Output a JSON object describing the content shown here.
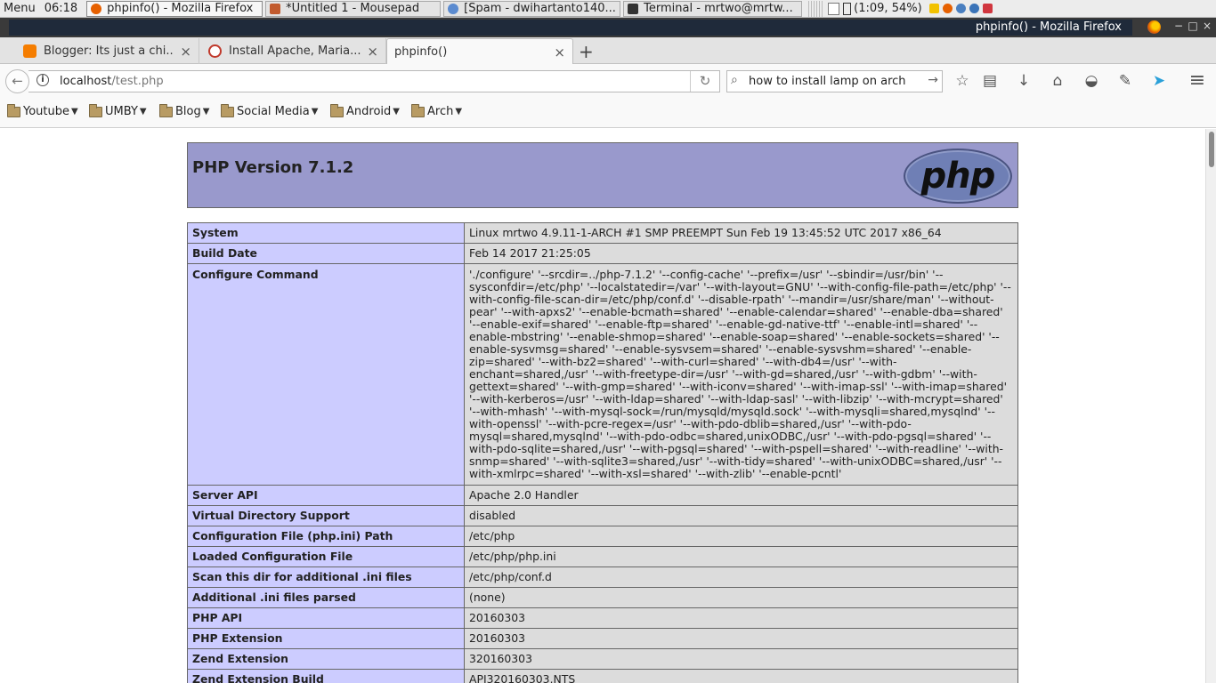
{
  "taskbar": {
    "menu": "Menu",
    "clock": "06:18",
    "tasks": [
      {
        "label": "phpinfo() - Mozilla Firefox",
        "color": "#e66000"
      },
      {
        "label": "*Untitled 1 - Mousepad",
        "color": "#c25b2e"
      },
      {
        "label": "[Spam - dwihartanto140...",
        "color": "#5b8bd0"
      },
      {
        "label": "Terminal - mrtwo@mrtw...",
        "color": "#333333"
      }
    ],
    "battery": "(1:09, 54%)"
  },
  "window": {
    "title": "phpinfo() - Mozilla Firefox",
    "controls": {
      "minimize": "−",
      "maximize": "□",
      "close": "×"
    }
  },
  "tabs": [
    {
      "label": "Blogger: Its just a chi...",
      "favicon_color": "#f57d00"
    },
    {
      "label": "Install Apache, Maria...",
      "favicon_color": "#c0392b"
    },
    {
      "label": "phpinfo()",
      "favicon_color": ""
    }
  ],
  "newtab": "+",
  "navbar": {
    "back": "←",
    "info": "i",
    "url_host": "localhost",
    "url_path": "/test.php",
    "reload": "↻",
    "search_icon": "magnifier-icon",
    "search_text": "how to install lamp on arch",
    "search_go": "→",
    "icons": {
      "bookmark_star": "☆",
      "reading_list": "▤",
      "downloads": "↓",
      "home": "⌂",
      "pocket": "◒",
      "extension": "✎",
      "telegram": "➤",
      "menu": "≡"
    }
  },
  "bookmarks": [
    "Youtube",
    "UMBY",
    "Blog",
    "Social Media",
    "Android",
    "Arch"
  ],
  "php": {
    "version_title": "PHP Version 7.1.2",
    "logo_text": "php",
    "rows": [
      {
        "key": "System",
        "value": "Linux mrtwo 4.9.11-1-ARCH #1 SMP PREEMPT Sun Feb 19 13:45:52 UTC 2017 x86_64"
      },
      {
        "key": "Build Date",
        "value": "Feb 14 2017 21:25:05"
      },
      {
        "key": "Configure Command",
        "value": "'./configure' '--srcdir=../php-7.1.2' '--config-cache' '--prefix=/usr' '--sbindir=/usr/bin' '--sysconfdir=/etc/php' '--localstatedir=/var' '--with-layout=GNU' '--with-config-file-path=/etc/php' '--with-config-file-scan-dir=/etc/php/conf.d' '--disable-rpath' '--mandir=/usr/share/man' '--without-pear' '--with-apxs2' '--enable-bcmath=shared' '--enable-calendar=shared' '--enable-dba=shared' '--enable-exif=shared' '--enable-ftp=shared' '--enable-gd-native-ttf' '--enable-intl=shared' '--enable-mbstring' '--enable-shmop=shared' '--enable-soap=shared' '--enable-sockets=shared' '--enable-sysvmsg=shared' '--enable-sysvsem=shared' '--enable-sysvshm=shared' '--enable-zip=shared' '--with-bz2=shared' '--with-curl=shared' '--with-db4=/usr' '--with-enchant=shared,/usr' '--with-freetype-dir=/usr' '--with-gd=shared,/usr' '--with-gdbm' '--with-gettext=shared' '--with-gmp=shared' '--with-iconv=shared' '--with-imap-ssl' '--with-imap=shared' '--with-kerberos=/usr' '--with-ldap=shared' '--with-ldap-sasl' '--with-libzip' '--with-mcrypt=shared' '--with-mhash' '--with-mysql-sock=/run/mysqld/mysqld.sock' '--with-mysqli=shared,mysqlnd' '--with-openssl' '--with-pcre-regex=/usr' '--with-pdo-dblib=shared,/usr' '--with-pdo-mysql=shared,mysqlnd' '--with-pdo-odbc=shared,unixODBC,/usr' '--with-pdo-pgsql=shared' '--with-pdo-sqlite=shared,/usr' '--with-pgsql=shared' '--with-pspell=shared' '--with-readline' '--with-snmp=shared' '--with-sqlite3=shared,/usr' '--with-tidy=shared' '--with-unixODBC=shared,/usr' '--with-xmlrpc=shared' '--with-xsl=shared' '--with-zlib' '--enable-pcntl'"
      },
      {
        "key": "Server API",
        "value": "Apache 2.0 Handler"
      },
      {
        "key": "Virtual Directory Support",
        "value": "disabled"
      },
      {
        "key": "Configuration File (php.ini) Path",
        "value": "/etc/php"
      },
      {
        "key": "Loaded Configuration File",
        "value": "/etc/php/php.ini"
      },
      {
        "key": "Scan this dir for additional .ini files",
        "value": "/etc/php/conf.d"
      },
      {
        "key": "Additional .ini files parsed",
        "value": "(none)"
      },
      {
        "key": "PHP API",
        "value": "20160303"
      },
      {
        "key": "PHP Extension",
        "value": "20160303"
      },
      {
        "key": "Zend Extension",
        "value": "320160303"
      },
      {
        "key": "Zend Extension Build",
        "value": "API320160303,NTS"
      }
    ]
  },
  "colors": {
    "header_bg": "#9999cc",
    "key_bg": "#ccccff",
    "value_bg": "#dcdcdc"
  }
}
